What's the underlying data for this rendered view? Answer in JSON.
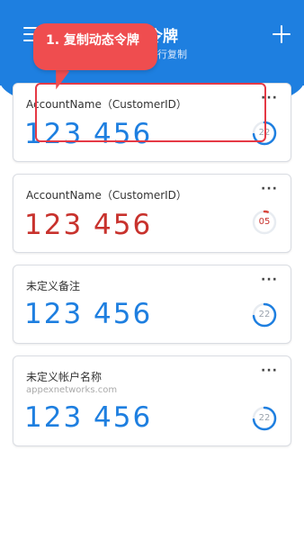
{
  "header": {
    "title": "令牌",
    "subtitle": "进行复制",
    "menu_icon": "menu-icon",
    "add_icon": "plus-icon",
    "bg_color": "#1e7fe0"
  },
  "callout": {
    "text": "1. 复制动态令牌",
    "color": "#ef4d4f"
  },
  "tokens": [
    {
      "name": "AccountName（CustomerID）",
      "sub": "",
      "code": "123 456",
      "timer": "22",
      "code_color": "#1e7fe0",
      "timer_fraction": 0.73,
      "timer_color": "#1e7fe0",
      "more": "···"
    },
    {
      "name": "AccountName（CustomerID）",
      "sub": "",
      "code": "123 456",
      "timer": "05",
      "code_color": "#c8322d",
      "timer_fraction": 0.05,
      "timer_color": "#d9453b",
      "more": "···"
    },
    {
      "name": "未定义备注",
      "sub": "",
      "code": "123 456",
      "timer": "22",
      "code_color": "#1e7fe0",
      "timer_fraction": 0.73,
      "timer_color": "#1e7fe0",
      "more": "···"
    },
    {
      "name": "未定义帐户名称",
      "sub": "appexnetworks.com",
      "code": "123 456",
      "timer": "22",
      "code_color": "#1e7fe0",
      "timer_fraction": 0.73,
      "timer_color": "#1e7fe0",
      "more": "···"
    }
  ]
}
